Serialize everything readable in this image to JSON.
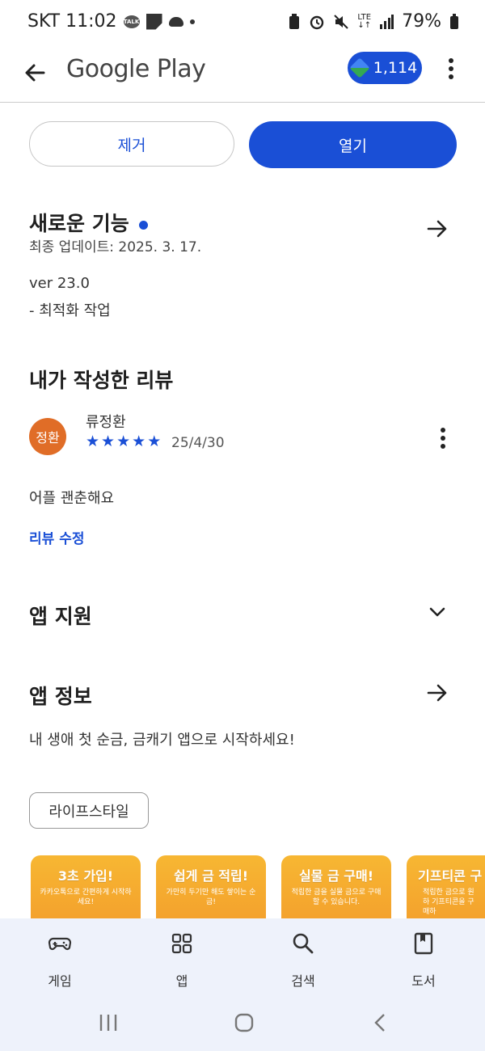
{
  "status_bar": {
    "carrier_time": "SKT 11:02",
    "talk_badge": "TALK",
    "network": "LTE",
    "battery": "79%"
  },
  "appbar": {
    "title": "Google Play",
    "points": "1,114"
  },
  "actions": {
    "remove_label": "제거",
    "open_label": "열기"
  },
  "whats_new": {
    "title": "새로운 기능",
    "updated": "최종 업데이트: 2025. 3. 17.",
    "version": "ver 23.0",
    "note": "- 최적화 작업"
  },
  "my_review": {
    "title": "내가 작성한 리뷰",
    "avatar_text": "정환",
    "reviewer": "류정환",
    "rating": 5,
    "date": "25/4/30",
    "text": "어플 괜춘해요",
    "edit_label": "리뷰 수정"
  },
  "app_support": {
    "title": "앱 지원"
  },
  "app_info": {
    "title": "앱 정보",
    "description": "내 생애 첫 순금, 금캐기 앱으로 시작하세요!",
    "category_chip": "라이프스타일"
  },
  "screenshots": [
    {
      "title": "3초 가입!",
      "subtitle": "카카오톡으로 간편하게 시작하세요!"
    },
    {
      "title": "쉽게 금 적립!",
      "subtitle": "가만히 두기만 해도 쌓이는 순금!"
    },
    {
      "title": "실물 금 구매!",
      "subtitle": "적립한 금을 실물 금으로 구매 할 수 있습니다."
    },
    {
      "title": "기프티콘 구",
      "subtitle": "적립한 금으로 원하 기프티콘을 구매하"
    }
  ],
  "bottom_nav": [
    {
      "label": "게임",
      "icon": "gamepad-icon"
    },
    {
      "label": "앱",
      "icon": "apps-grid-icon"
    },
    {
      "label": "검색",
      "icon": "search-icon"
    },
    {
      "label": "도서",
      "icon": "book-icon"
    }
  ],
  "colors": {
    "accent": "#1a4fd6",
    "avatar": "#e06d27",
    "nav_bg": "#eef2fb",
    "screenshot_bg": "#f7b733"
  }
}
